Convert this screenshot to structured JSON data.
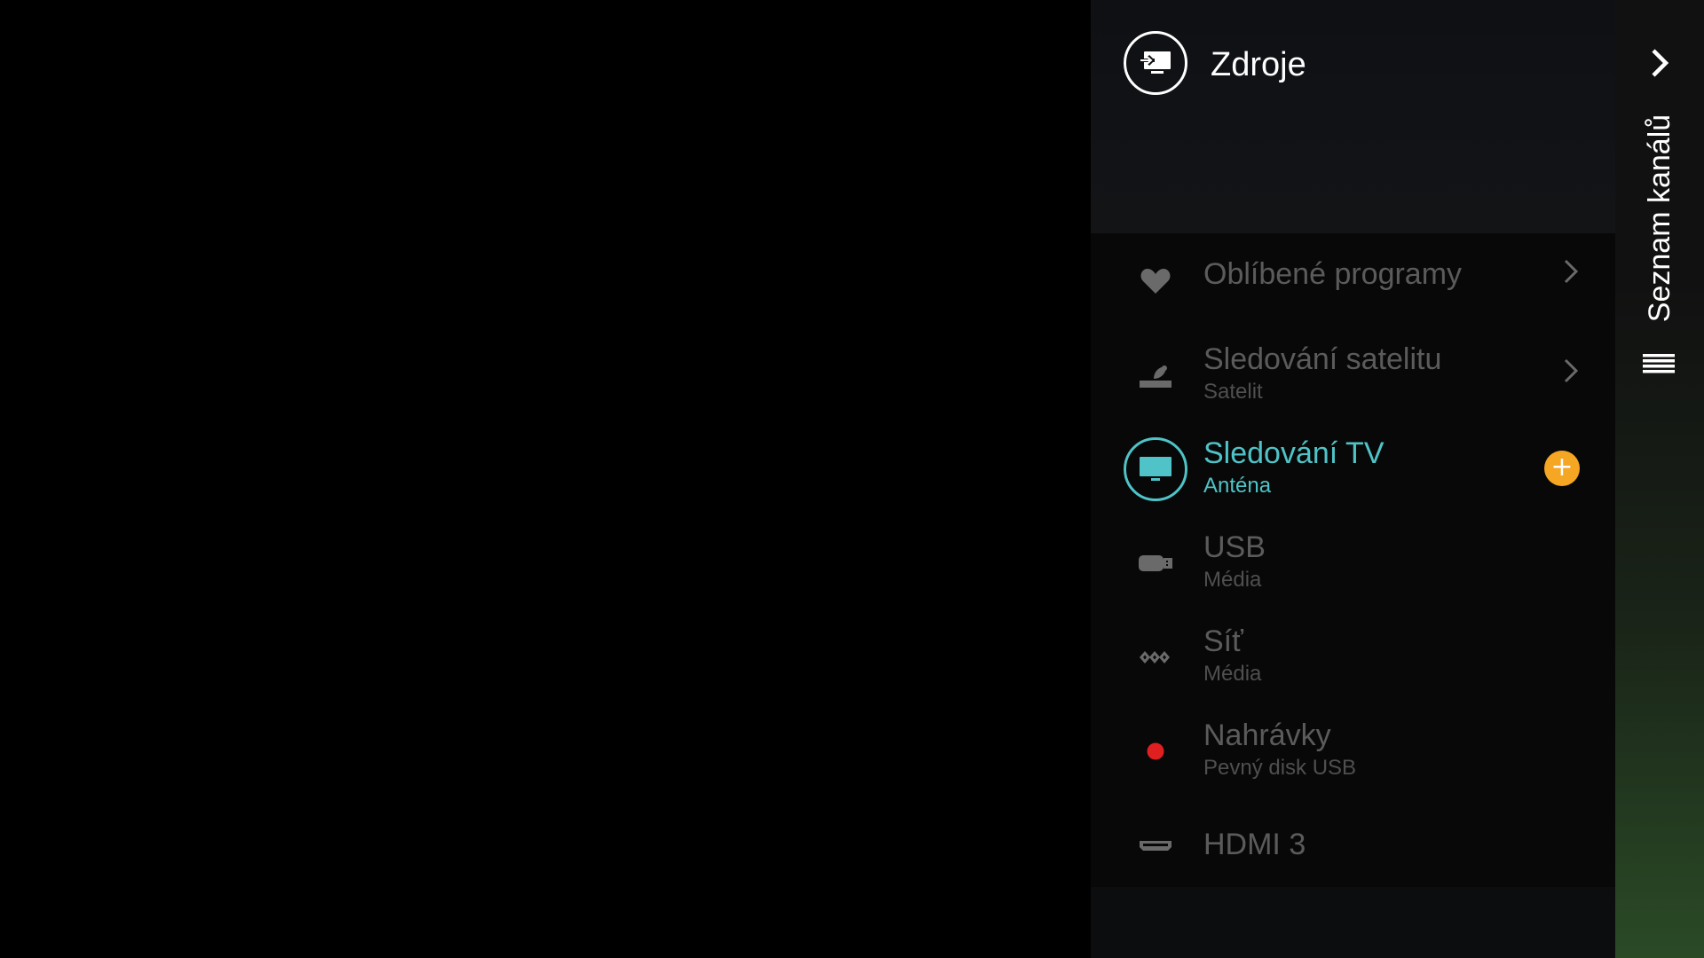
{
  "sources_panel": {
    "title": "Zdroje",
    "header_icon": "source-input-icon",
    "items": [
      {
        "label": "Oblíbené programy",
        "sublabel": "",
        "icon": "heart-icon",
        "has_chevron": true,
        "active": false
      },
      {
        "label": "Sledování satelitu",
        "sublabel": "Satelit",
        "icon": "satellite-dish-icon",
        "has_chevron": true,
        "active": false
      },
      {
        "label": "Sledování TV",
        "sublabel": "Anténa",
        "icon": "tv-icon",
        "has_chevron": false,
        "active": true,
        "action": "+"
      },
      {
        "label": "USB",
        "sublabel": "Média",
        "icon": "usb-icon",
        "has_chevron": false,
        "active": false
      },
      {
        "label": "Síť",
        "sublabel": "Média",
        "icon": "network-icon",
        "has_chevron": false,
        "active": false
      },
      {
        "label": "Nahrávky",
        "sublabel": "Pevný disk USB",
        "icon": "record-icon",
        "has_chevron": false,
        "active": false
      },
      {
        "label": "HDMI 3",
        "sublabel": "",
        "icon": "hdmi-icon",
        "has_chevron": false,
        "active": false
      }
    ]
  },
  "side_tab": {
    "title": "Seznam kanálů",
    "chevron_icon": "chevron-right-icon",
    "menu_icon": "list-icon"
  },
  "colors": {
    "background": "#000000",
    "accent": "#4fc3c7",
    "inactive_text": "#5b5b5b",
    "plus_button": "#f5a623",
    "record_dot": "#e02020",
    "side_tab_gradient_bottom": "#2a4a26"
  }
}
